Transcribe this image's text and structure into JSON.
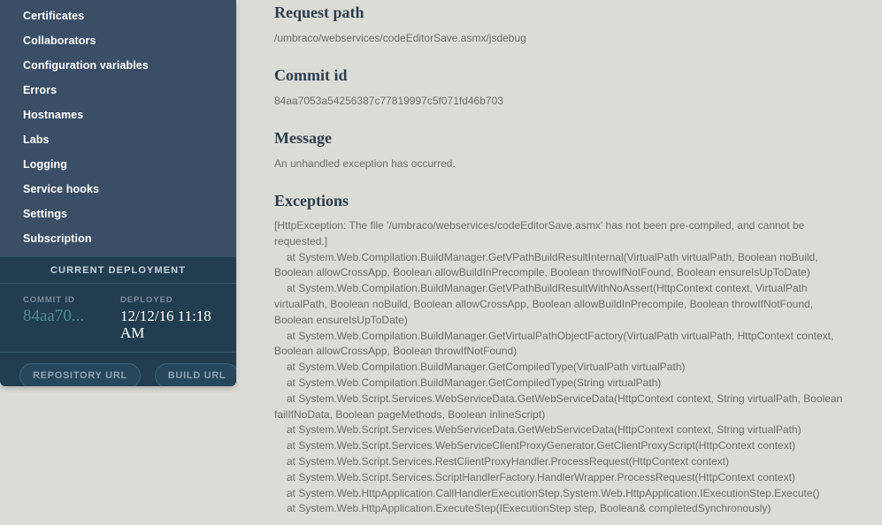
{
  "sidebar": {
    "nav_items": [
      {
        "label": "Certificates"
      },
      {
        "label": "Collaborators"
      },
      {
        "label": "Configuration variables"
      },
      {
        "label": "Errors"
      },
      {
        "label": "Hostnames"
      },
      {
        "label": "Labs"
      },
      {
        "label": "Logging"
      },
      {
        "label": "Service hooks"
      },
      {
        "label": "Settings"
      },
      {
        "label": "Subscription"
      }
    ],
    "deployment": {
      "header": "CURRENT DEPLOYMENT",
      "commit_label": "COMMIT ID",
      "commit_value": "84aa70...",
      "deployed_label": "DEPLOYED",
      "deployed_value": "12/12/16 11:18 AM",
      "repository_button": "REPOSITORY URL",
      "build_button": "BUILD URL"
    }
  },
  "main": {
    "request_path": {
      "title": "Request path",
      "value": "/umbraco/webservices/codeEditorSave.asmx/jsdebug"
    },
    "commit_id": {
      "title": "Commit id",
      "value": "84aa7053a54256387c77819997c5f071fd46b703"
    },
    "message": {
      "title": "Message",
      "value": "An unhandled exception has occurred."
    },
    "exceptions": {
      "title": "Exceptions",
      "header": "[HttpException: The file '/umbraco/webservices/codeEditorSave.asmx' has not been pre-compiled, and cannot be requested.]",
      "trace": [
        "at System.Web.Compilation.BuildManager.GetVPathBuildResultInternal(VirtualPath virtualPath, Boolean noBuild, Boolean allowCrossApp, Boolean allowBuildInPrecompile, Boolean throwIfNotFound, Boolean ensureIsUpToDate)",
        "at System.Web.Compilation.BuildManager.GetVPathBuildResultWithNoAssert(HttpContext context, VirtualPath virtualPath, Boolean noBuild, Boolean allowCrossApp, Boolean allowBuildInPrecompile, Boolean throwIfNotFound, Boolean ensureIsUpToDate)",
        "at System.Web.Compilation.BuildManager.GetVirtualPathObjectFactory(VirtualPath virtualPath, HttpContext context, Boolean allowCrossApp, Boolean throwIfNotFound)",
        "at System.Web.Compilation.BuildManager.GetCompiledType(VirtualPath virtualPath)",
        "at System.Web.Compilation.BuildManager.GetCompiledType(String virtualPath)",
        "at System.Web.Script.Services.WebServiceData.GetWebServiceData(HttpContext context, String virtualPath, Boolean failIfNoData, Boolean pageMethods, Boolean inlineScript)",
        "at System.Web.Script.Services.WebServiceData.GetWebServiceData(HttpContext context, String virtualPath)",
        "at System.Web.Script.Services.WebServiceClientProxyGenerator.GetClientProxyScript(HttpContext context)",
        "at System.Web.Script.Services.RestClientProxyHandler.ProcessRequest(HttpContext context)",
        "at System.Web.Script.Services.ScriptHandlerFactory.HandlerWrapper.ProcessRequest(HttpContext context)",
        "at System.Web.HttpApplication.CallHandlerExecutionStep.System.Web.HttpApplication.IExecutionStep.Execute()",
        "at System.Web.HttpApplication.ExecuteStep(IExecutionStep step, Boolean& completedSynchronously)"
      ]
    }
  }
}
